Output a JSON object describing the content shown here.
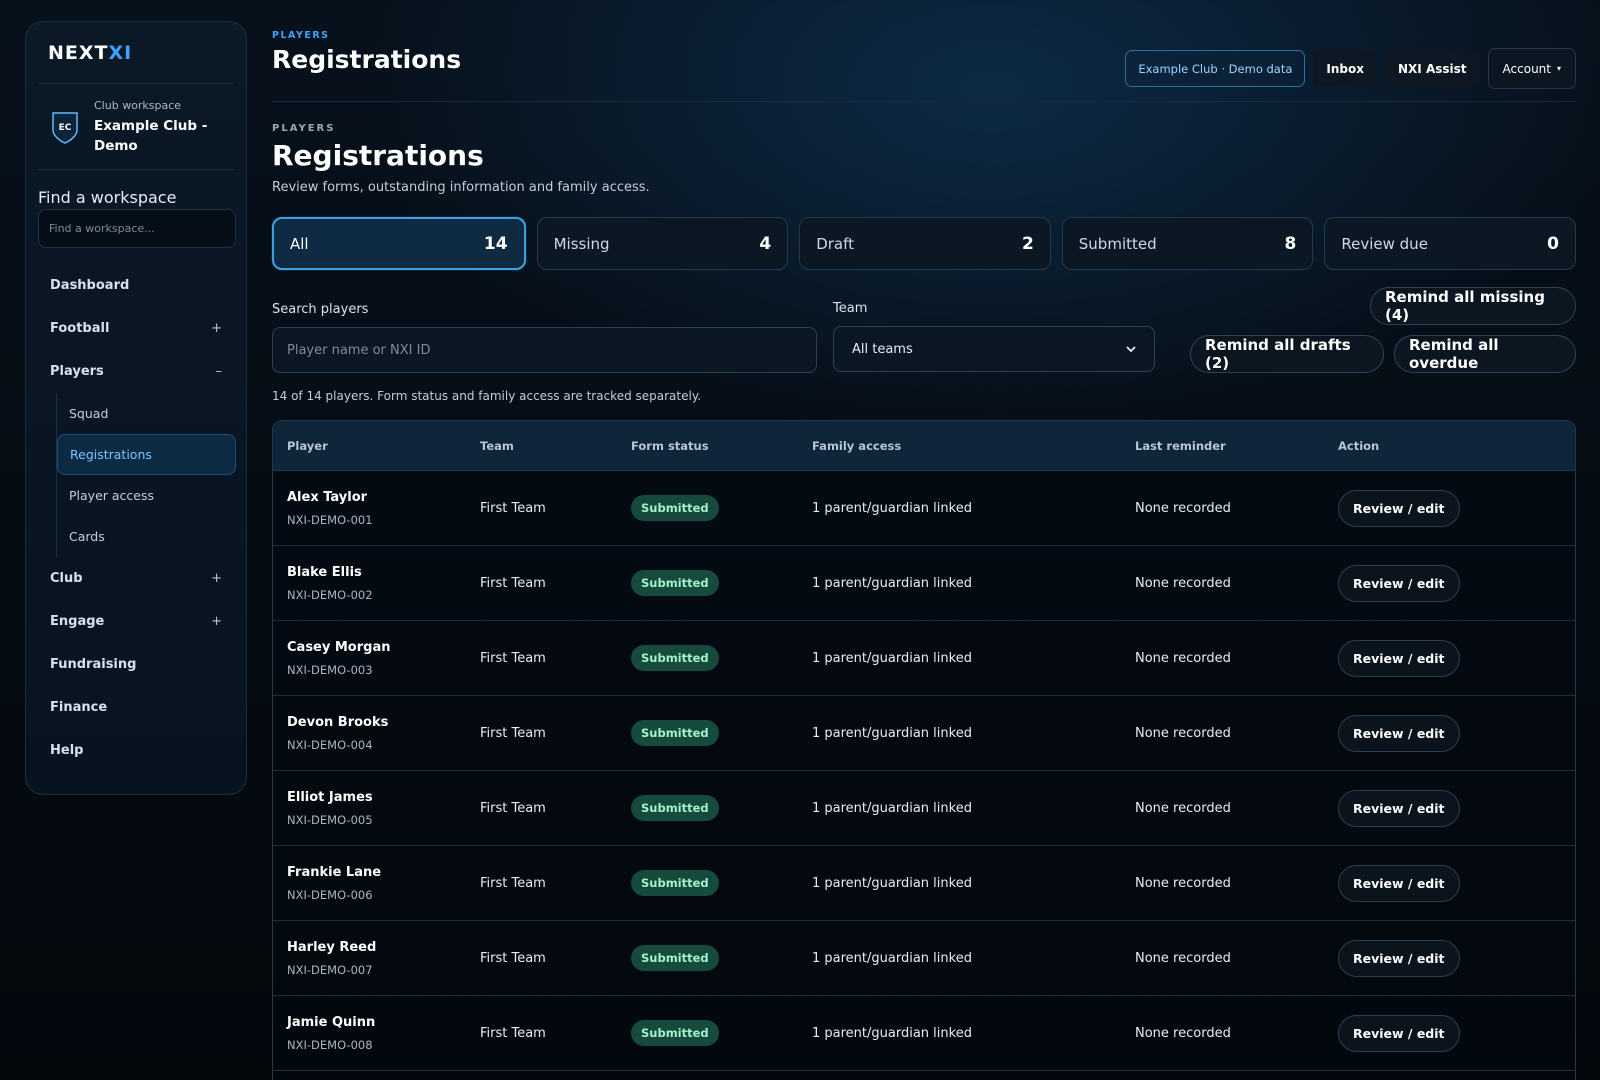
{
  "brand": {
    "prefix": "NEXT",
    "suffix": "XI"
  },
  "workspace": {
    "label": "Club workspace",
    "name_line1": "Example Club -",
    "name_line2": "Demo",
    "badge": "EC"
  },
  "find": {
    "title": "Find a workspace",
    "placeholder": "Find a workspace..."
  },
  "nav": {
    "dashboard": "Dashboard",
    "football": "Football",
    "players": "Players",
    "club": "Club",
    "engage": "Engage",
    "fundraising": "Fundraising",
    "finance": "Finance",
    "help": "Help",
    "plus": "+",
    "minus": "–",
    "players_sub": {
      "squad": "Squad",
      "registrations": "Registrations",
      "player_access": "Player access",
      "cards": "Cards"
    }
  },
  "header": {
    "eyebrow": "PLAYERS",
    "title": "Registrations",
    "demo_chip": "Example Club · Demo data",
    "inbox": "Inbox",
    "assist": "NXI Assist",
    "account": "Account",
    "account_caret": "▾"
  },
  "page": {
    "eyebrow": "PLAYERS",
    "title": "Registrations",
    "subtitle": "Review forms, outstanding information and family access."
  },
  "stats": [
    {
      "label": "All",
      "value": "14"
    },
    {
      "label": "Missing",
      "value": "4"
    },
    {
      "label": "Draft",
      "value": "2"
    },
    {
      "label": "Submitted",
      "value": "8"
    },
    {
      "label": "Review due",
      "value": "0"
    }
  ],
  "filters": {
    "search_label": "Search players",
    "search_placeholder": "Player name or NXI ID",
    "team_label": "Team",
    "team_value": "All teams",
    "remind_missing": "Remind all missing (4)",
    "remind_drafts": "Remind all drafts (2)",
    "remind_overdue": "Remind all overdue",
    "meta": "14 of 14 players. Form status and family access are tracked separately."
  },
  "table": {
    "headers": [
      "Player",
      "Team",
      "Form status",
      "Family access",
      "Last reminder",
      "Action"
    ],
    "rows": [
      {
        "name": "Alex Taylor",
        "id": "NXI-DEMO-001",
        "team": "First Team",
        "status": "Submitted",
        "family": "1 parent/guardian linked",
        "reminder": "None recorded",
        "action": "Review / edit"
      },
      {
        "name": "Blake Ellis",
        "id": "NXI-DEMO-002",
        "team": "First Team",
        "status": "Submitted",
        "family": "1 parent/guardian linked",
        "reminder": "None recorded",
        "action": "Review / edit"
      },
      {
        "name": "Casey Morgan",
        "id": "NXI-DEMO-003",
        "team": "First Team",
        "status": "Submitted",
        "family": "1 parent/guardian linked",
        "reminder": "None recorded",
        "action": "Review / edit"
      },
      {
        "name": "Devon Brooks",
        "id": "NXI-DEMO-004",
        "team": "First Team",
        "status": "Submitted",
        "family": "1 parent/guardian linked",
        "reminder": "None recorded",
        "action": "Review / edit"
      },
      {
        "name": "Elliot James",
        "id": "NXI-DEMO-005",
        "team": "First Team",
        "status": "Submitted",
        "family": "1 parent/guardian linked",
        "reminder": "None recorded",
        "action": "Review / edit"
      },
      {
        "name": "Frankie Lane",
        "id": "NXI-DEMO-006",
        "team": "First Team",
        "status": "Submitted",
        "family": "1 parent/guardian linked",
        "reminder": "None recorded",
        "action": "Review / edit"
      },
      {
        "name": "Harley Reed",
        "id": "NXI-DEMO-007",
        "team": "First Team",
        "status": "Submitted",
        "family": "1 parent/guardian linked",
        "reminder": "None recorded",
        "action": "Review / edit"
      },
      {
        "name": "Jamie Quinn",
        "id": "NXI-DEMO-008",
        "team": "First Team",
        "status": "Submitted",
        "family": "1 parent/guardian linked",
        "reminder": "None recorded",
        "action": "Review / edit"
      }
    ]
  },
  "colors": {
    "accent": "#3aa6ff",
    "badge_bg": "#154a3c",
    "badge_text": "#a5f0cd"
  }
}
